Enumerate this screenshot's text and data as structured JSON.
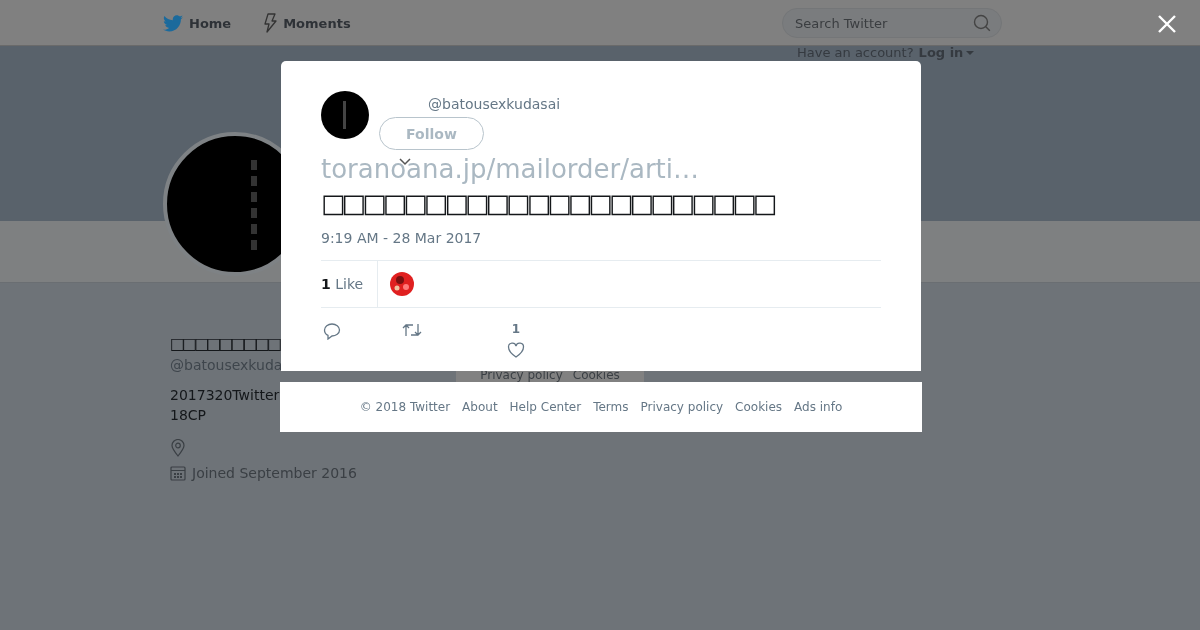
{
  "nav": {
    "items": [
      {
        "kind": "bird",
        "label": "Home"
      },
      {
        "kind": "bolt",
        "label": "Moments"
      }
    ],
    "search": {
      "placeholder": "Search Twitter"
    },
    "login": {
      "prompt": "Have an account?",
      "link": "Log in"
    }
  },
  "profile": {
    "name": "□□□□□□□□□",
    "handle": "@batousexkuda",
    "bio": [
      "2017320Twitter",
      "18CP"
    ],
    "joined": "Joined September 2016",
    "footer_links": [
      "Privacy policy",
      "Cookies"
    ]
  },
  "tweet": {
    "handle": "@batousexkudasai",
    "follow": "Follow",
    "link": "toranoana.jp/mailorder/arti…",
    "text": "□□□□□□□□□□□□□□□□□□□□□□",
    "time": "9:19 AM - 28 Mar 2017",
    "likes": {
      "count": "1",
      "label": "Like"
    },
    "like_count": "1"
  },
  "footer": [
    "© 2018 Twitter",
    "About",
    "Help Center",
    "Terms",
    "Privacy policy",
    "Cookies",
    "Ads info"
  ]
}
